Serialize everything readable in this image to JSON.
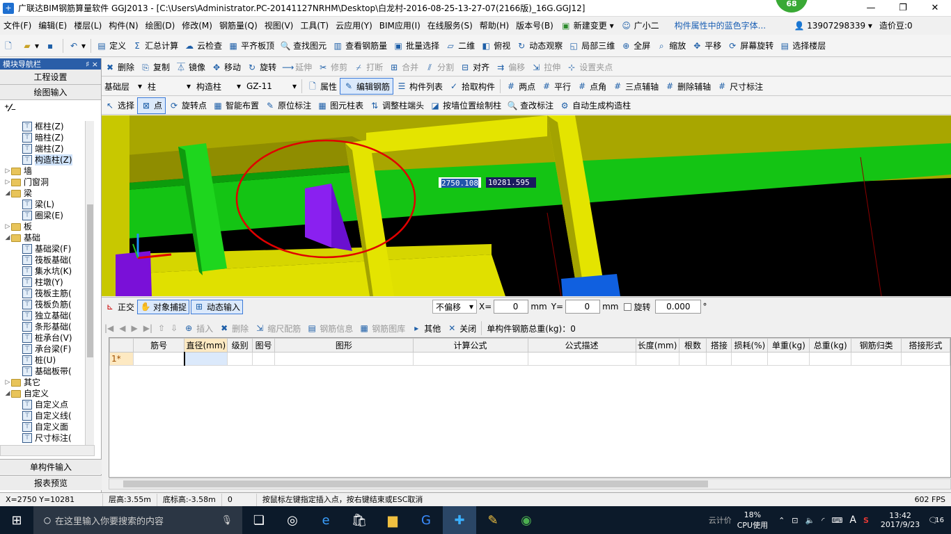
{
  "titlebar": {
    "title": "广联达BIM钢筋算量软件 GGJ2013 - [C:\\Users\\Administrator.PC-20141127NRHM\\Desktop\\白龙村-2016-08-25-13-27-07(2166版)_16G.GGJ12]",
    "badge": "68",
    "min": "—",
    "max": "❐",
    "close": "✕"
  },
  "menu": {
    "items": [
      "文件(F)",
      "编辑(E)",
      "楼层(L)",
      "构件(N)",
      "绘图(D)",
      "修改(M)",
      "钢筋量(Q)",
      "视图(V)",
      "工具(T)",
      "云应用(Y)",
      "BIM应用(I)",
      "在线服务(S)",
      "帮助(H)",
      "版本号(B)"
    ],
    "new_change": "新建变更",
    "assistant": "广小二",
    "hint": "构件属性中的蓝色字体...",
    "phone": "13907298339",
    "coins": "造价豆:0"
  },
  "toolbar1": {
    "items": [
      "定义",
      "汇总计算",
      "云检查",
      "平齐板顶",
      "查找图元",
      "查看钢筋量",
      "批量选择",
      "二维",
      "俯视",
      "动态观察",
      "局部三维",
      "全屏",
      "缩放",
      "平移",
      "屏幕旋转",
      "选择楼层"
    ]
  },
  "toolbar2": {
    "items": [
      "删除",
      "复制",
      "镜像",
      "移动",
      "旋转",
      "延伸",
      "修剪",
      "打断",
      "合并",
      "分割",
      "对齐",
      "偏移",
      "拉伸",
      "设置夹点"
    ]
  },
  "toolbar3": {
    "floor": "基础层",
    "type": "柱",
    "subtype": "构造柱",
    "name": "GZ-11",
    "items": [
      "属性",
      "编辑钢筋",
      "构件列表",
      "拾取构件"
    ],
    "axis": [
      "两点",
      "平行",
      "点角",
      "三点辅轴",
      "删除辅轴",
      "尺寸标注"
    ]
  },
  "toolbar4": {
    "items": [
      "选择",
      "点",
      "旋转点",
      "智能布置",
      "原位标注",
      "图元柱表",
      "调整柱端头",
      "按墙位置绘制柱",
      "查改标注",
      "自动生成构造柱"
    ]
  },
  "panel": {
    "title": "模块导航栏",
    "pin": "♯ ×",
    "btn_project": "工程设置",
    "btn_draw": "绘图输入",
    "btn_single": "单构件输入",
    "btn_report": "报表预览"
  },
  "tree": [
    {
      "label": "框柱(Z)",
      "level": 2,
      "kind": "leaf"
    },
    {
      "label": "暗柱(Z)",
      "level": 2,
      "kind": "leaf"
    },
    {
      "label": "端柱(Z)",
      "level": 2,
      "kind": "leaf"
    },
    {
      "label": "构造柱(Z)",
      "level": 2,
      "kind": "leaf",
      "sel": true
    },
    {
      "label": "墙",
      "level": 1,
      "kind": "folder",
      "tw": "▷"
    },
    {
      "label": "门窗洞",
      "level": 1,
      "kind": "folder",
      "tw": "▷"
    },
    {
      "label": "梁",
      "level": 1,
      "kind": "folder",
      "tw": "◢"
    },
    {
      "label": "梁(L)",
      "level": 2,
      "kind": "leaf"
    },
    {
      "label": "圈梁(E)",
      "level": 2,
      "kind": "leaf"
    },
    {
      "label": "板",
      "level": 1,
      "kind": "folder",
      "tw": "▷"
    },
    {
      "label": "基础",
      "level": 1,
      "kind": "folder",
      "tw": "◢"
    },
    {
      "label": "基础梁(F)",
      "level": 2,
      "kind": "leaf"
    },
    {
      "label": "筏板基础(",
      "level": 2,
      "kind": "leaf"
    },
    {
      "label": "集水坑(K)",
      "level": 2,
      "kind": "leaf"
    },
    {
      "label": "柱墩(Y)",
      "level": 2,
      "kind": "leaf"
    },
    {
      "label": "筏板主筋(",
      "level": 2,
      "kind": "leaf"
    },
    {
      "label": "筏板负筋(",
      "level": 2,
      "kind": "leaf"
    },
    {
      "label": "独立基础(",
      "level": 2,
      "kind": "leaf"
    },
    {
      "label": "条形基础(",
      "level": 2,
      "kind": "leaf"
    },
    {
      "label": "桩承台(V)",
      "level": 2,
      "kind": "leaf"
    },
    {
      "label": "承台梁(F)",
      "level": 2,
      "kind": "leaf"
    },
    {
      "label": "桩(U)",
      "level": 2,
      "kind": "leaf"
    },
    {
      "label": "基础板带(",
      "level": 2,
      "kind": "leaf"
    },
    {
      "label": "其它",
      "level": 1,
      "kind": "folder",
      "tw": "▷"
    },
    {
      "label": "自定义",
      "level": 1,
      "kind": "folder",
      "tw": "◢"
    },
    {
      "label": "自定义点",
      "level": 2,
      "kind": "leaf"
    },
    {
      "label": "自定义线(",
      "level": 2,
      "kind": "leaf"
    },
    {
      "label": "自定义面",
      "level": 2,
      "kind": "leaf"
    },
    {
      "label": "尺寸标注(",
      "level": 2,
      "kind": "leaf"
    }
  ],
  "viewport": {
    "coord_x": "2750.108",
    "coord_y": "10281.595"
  },
  "snap": {
    "ortho": "正交",
    "snap": "对象捕捉",
    "dynamic": "动态输入",
    "offset": "不偏移",
    "x_label": "X=",
    "x_val": "0",
    "mm1": "mm",
    "y_label": "Y=",
    "y_val": "0",
    "mm2": "mm",
    "rotate": "旋转",
    "rot_val": "0.000",
    "deg": "°"
  },
  "rebar": {
    "items": [
      "插入",
      "删除",
      "缩尺配筋",
      "钢筋信息",
      "钢筋图库",
      "其他",
      "关闭"
    ],
    "total": "单构件钢筋总重(kg)：0"
  },
  "table": {
    "headers": [
      "",
      "筋号",
      "直径(mm)",
      "级别",
      "图号",
      "图形",
      "计算公式",
      "公式描述",
      "长度(mm)",
      "根数",
      "搭接",
      "损耗(%)",
      "单重(kg)",
      "总重(kg)",
      "钢筋归类",
      "搭接形式"
    ],
    "row1": "1*"
  },
  "status": {
    "xy": "X=2750 Y=10281",
    "floor_h": "层高:3.55m",
    "base_h": "底标高:-3.58m",
    "zero": "0",
    "msg": "按鼠标左键指定插入点，按右键结束或ESC取消",
    "fps": "602 FPS"
  },
  "taskbar": {
    "search": "在这里输入你要搜索的内容",
    "cloud": "云计价",
    "cpu": "18%",
    "cpu_label": "CPU使用",
    "time": "13:42",
    "date": "2017/9/23",
    "notif": "16",
    "ime": "A"
  }
}
